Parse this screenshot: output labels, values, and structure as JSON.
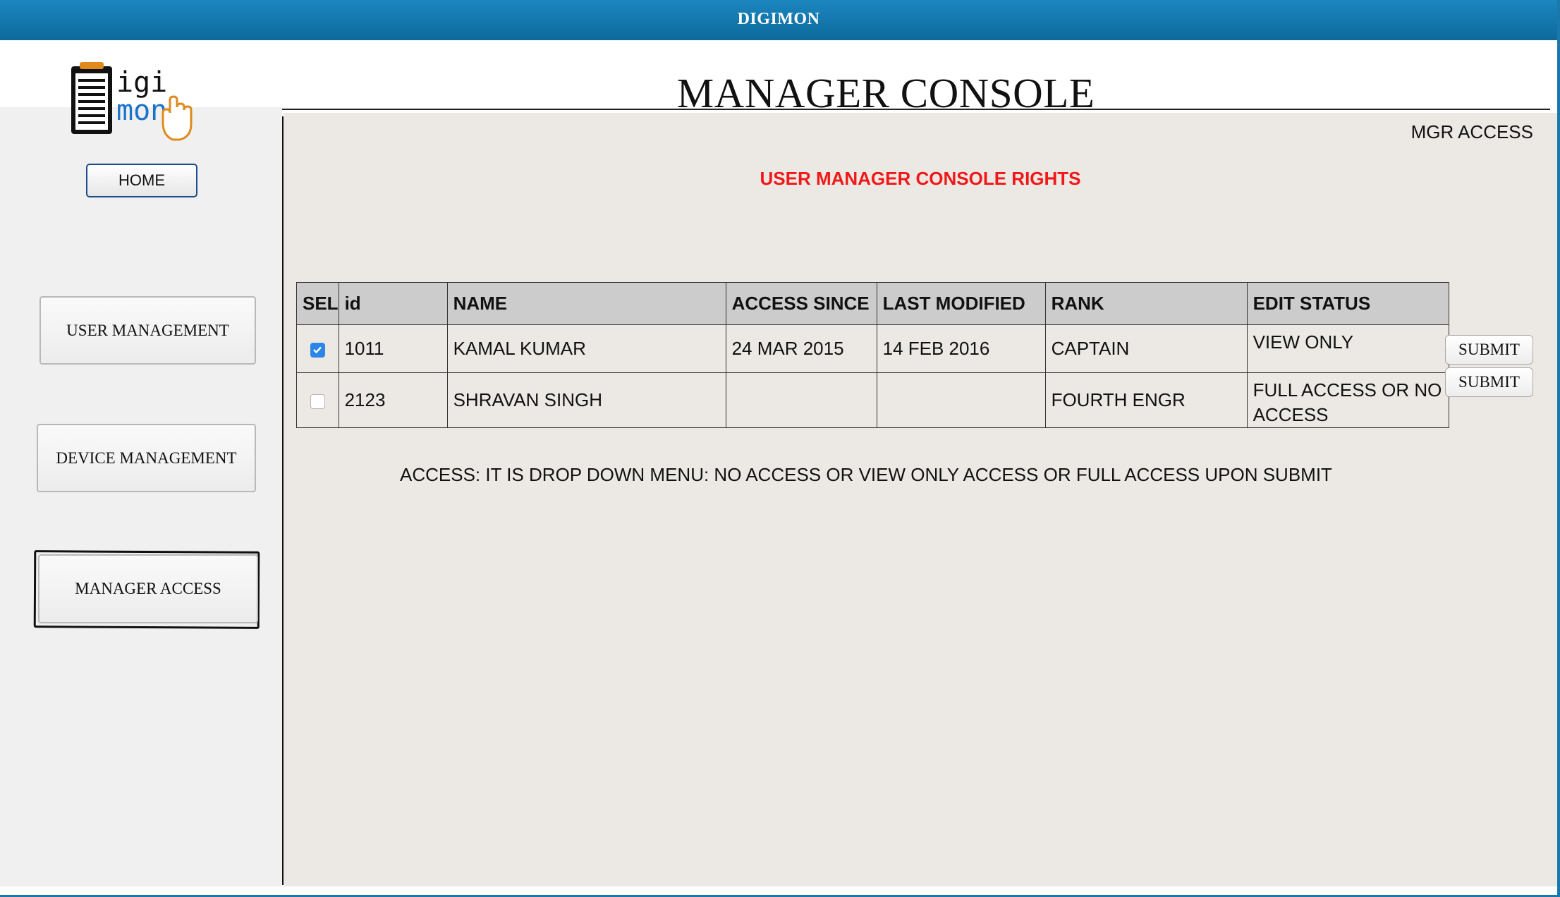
{
  "window": {
    "title": "DIGIMON"
  },
  "logo": {
    "text_top": "igi",
    "text_bottom": "mon"
  },
  "sidebar": {
    "home_label": "HOME",
    "buttons": [
      "USER MANAGEMENT",
      "DEVICE MANAGEMENT",
      "MANAGER ACCESS"
    ],
    "active": "MANAGER ACCESS"
  },
  "header": {
    "title": "MANAGER CONSOLE",
    "access_label": "MGR ACCESS"
  },
  "section_heading": "USER MANAGER CONSOLE RIGHTS",
  "table": {
    "columns": [
      "SEL",
      "id",
      "NAME",
      "ACCESS SINCE",
      "LAST MODIFIED",
      "RANK",
      "EDIT STATUS"
    ],
    "rows": [
      {
        "selected": true,
        "id": "1011",
        "name": "KAMAL KUMAR",
        "access_since": "24 MAR 2015",
        "last_modified": "14 FEB 2016",
        "rank": "CAPTAIN",
        "edit_status": "VIEW ONLY"
      },
      {
        "selected": false,
        "id": "2123",
        "name": "SHRAVAN SINGH",
        "access_since": "",
        "last_modified": "",
        "rank": "FOURTH ENGR",
        "edit_status": "FULL ACCESS OR NO ACCESS"
      }
    ],
    "submit_label": "SUBMIT"
  },
  "note": "ACCESS: IT IS DROP DOWN MENU: NO ACCESS OR VIEW ONLY ACCESS OR FULL ACCESS UPON SUBMIT",
  "colors": {
    "titlebar": "#1679b0",
    "heading": "#f01818",
    "panel": "#ece9e4",
    "checkbox": "#2b86e8"
  }
}
